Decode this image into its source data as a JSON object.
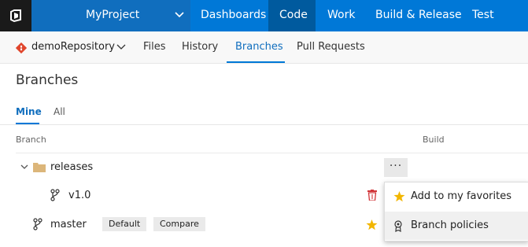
{
  "topbar": {
    "project": "MyProject",
    "nav": [
      "Dashboards",
      "Code",
      "Work",
      "Build & Release",
      "Test"
    ],
    "logo_icon": "vsts-logo-icon",
    "accent": "#0078d7"
  },
  "subbar": {
    "repo": "demoRepository",
    "tabs": [
      "Files",
      "History",
      "Branches",
      "Pull Requests"
    ],
    "active_tab": "Branches"
  },
  "page": {
    "title": "Branches",
    "pivots": [
      "Mine",
      "All"
    ],
    "active_pivot": "Mine"
  },
  "table": {
    "columns": [
      "Branch",
      "Build"
    ],
    "rows": [
      {
        "name": "releases",
        "type": "folder",
        "icon": "folder-icon"
      },
      {
        "name": "v1.0",
        "type": "branch",
        "icon": "branch-icon",
        "action_icon": "delete-icon"
      },
      {
        "name": "master",
        "type": "branch",
        "icon": "branch-icon",
        "badges": [
          "Default",
          "Compare"
        ],
        "favorite": true
      }
    ],
    "more_label": "···"
  },
  "context_menu": {
    "items": [
      {
        "label": "Add to my favorites",
        "icon": "star-icon"
      },
      {
        "label": "Branch policies",
        "icon": "policy-icon"
      }
    ]
  }
}
